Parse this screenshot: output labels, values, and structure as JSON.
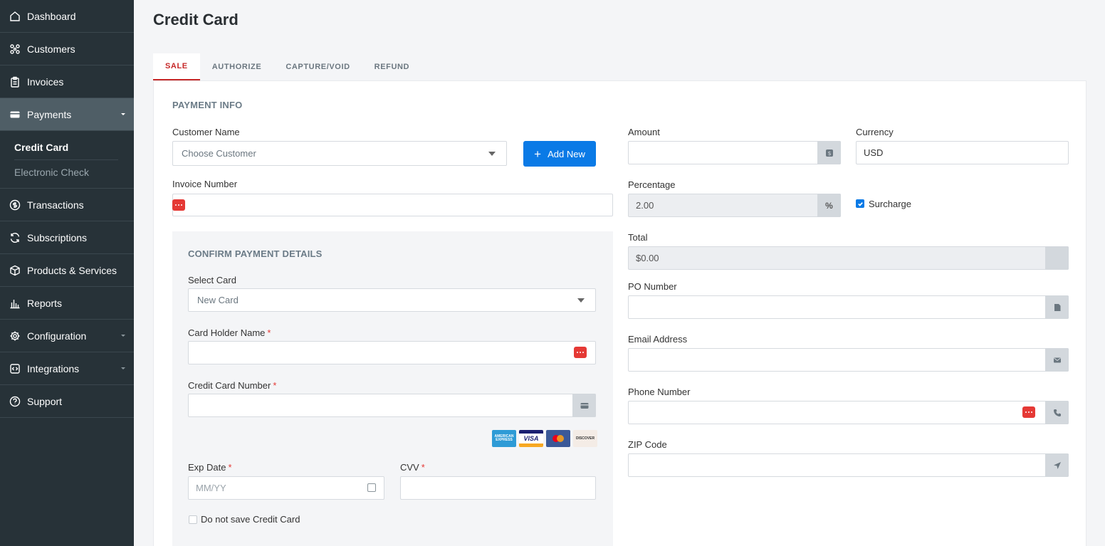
{
  "sidebar": {
    "items": [
      {
        "label": "Dashboard",
        "icon": "home-icon"
      },
      {
        "label": "Customers",
        "icon": "customers-icon"
      },
      {
        "label": "Invoices",
        "icon": "clipboard-icon"
      },
      {
        "label": "Payments",
        "icon": "card-icon"
      },
      {
        "label": "Transactions",
        "icon": "dollar-icon"
      },
      {
        "label": "Subscriptions",
        "icon": "refresh-icon"
      },
      {
        "label": "Products & Services",
        "icon": "box-icon"
      },
      {
        "label": "Reports",
        "icon": "bar-chart-icon"
      },
      {
        "label": "Configuration",
        "icon": "gear-icon"
      },
      {
        "label": "Integrations",
        "icon": "code-icon"
      },
      {
        "label": "Support",
        "icon": "help-icon"
      }
    ],
    "payments_sub": [
      "Credit Card",
      "Electronic Check"
    ]
  },
  "page": {
    "title": "Credit Card"
  },
  "tabs": [
    "SALE",
    "AUTHORIZE",
    "CAPTURE/VOID",
    "REFUND"
  ],
  "payment_info": {
    "title": "PAYMENT INFO",
    "customer_label": "Customer Name",
    "customer_placeholder": "Choose Customer",
    "add_new": "Add New",
    "invoice_label": "Invoice Number",
    "amount_label": "Amount",
    "currency_label": "Currency",
    "currency_value": "USD",
    "percentage_label": "Percentage",
    "percentage_value": "2.00",
    "percent_symbol": "%",
    "surcharge_label": "Surcharge",
    "surcharge_checked": true,
    "total_label": "Total",
    "total_value": "$0.00",
    "po_label": "PO Number",
    "email_label": "Email Address",
    "phone_label": "Phone Number",
    "zip_label": "ZIP Code"
  },
  "confirm": {
    "title": "CONFIRM PAYMENT DETAILS",
    "select_card_label": "Select Card",
    "select_card_value": "New Card",
    "holder_label": "Card Holder Name",
    "number_label": "Credit Card Number",
    "exp_label": "Exp Date",
    "exp_placeholder": "MM/YY",
    "cvv_label": "CVV",
    "required_mark": "*",
    "no_save_label": "Do not save Credit Card",
    "card_brands": [
      "AMERICAN EXPRESS",
      "VISA",
      "MASTERCARD",
      "DISCOVER"
    ]
  },
  "colors": {
    "sidebar": "#273238",
    "accent": "#0a7ae6",
    "active_tab": "#c62828",
    "required": "#e53935"
  }
}
